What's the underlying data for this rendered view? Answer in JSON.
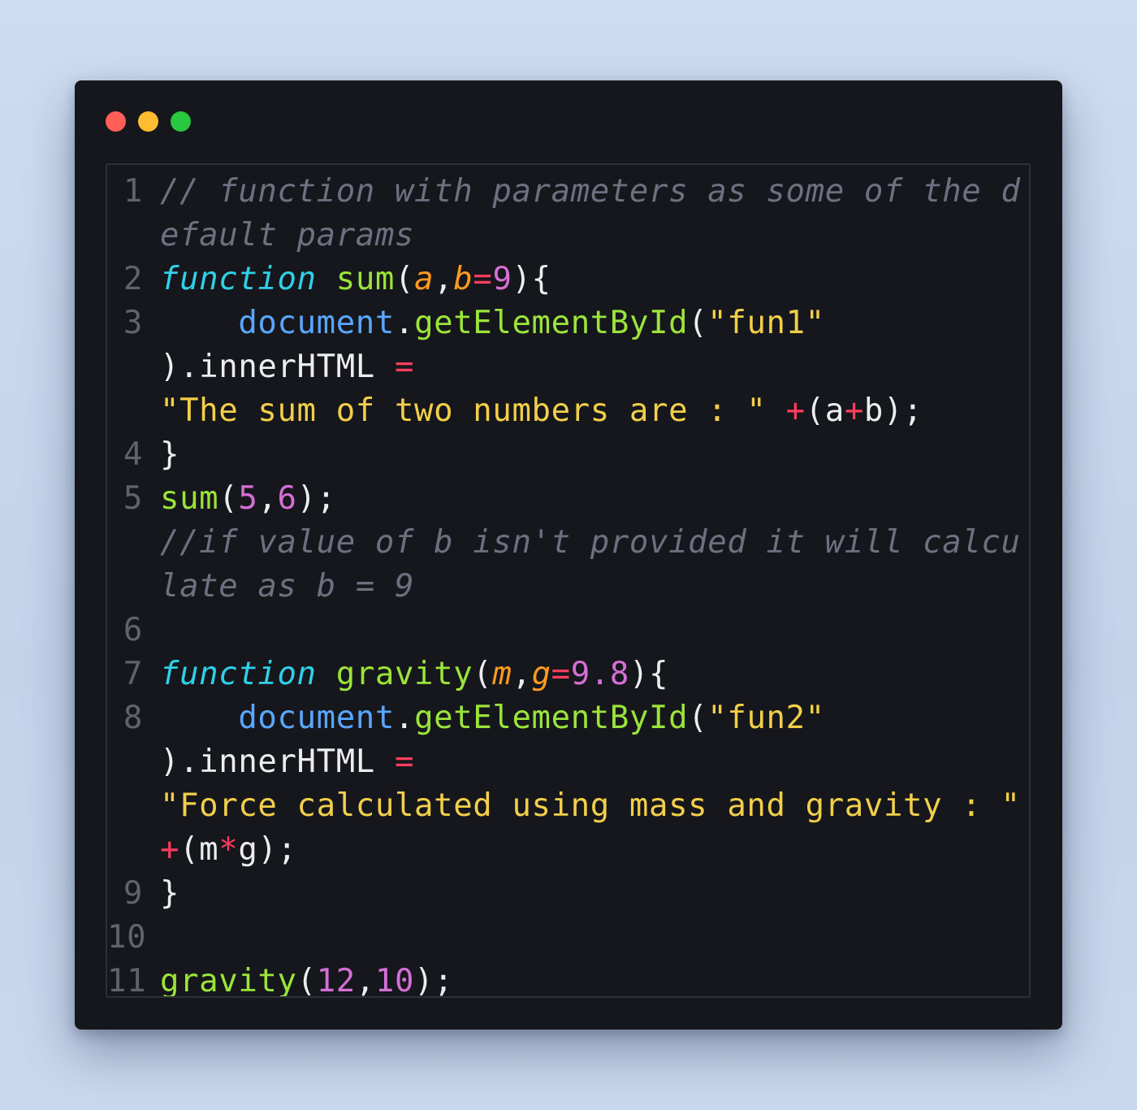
{
  "window": {
    "controls": [
      "close",
      "minimize",
      "maximize"
    ],
    "colors": {
      "close": "#ff5f57",
      "minimize": "#febc2e",
      "maximize": "#28c840"
    }
  },
  "code": {
    "numbers": [
      "1",
      "2",
      "3",
      "4",
      "5",
      "6",
      "7",
      "8",
      "9",
      "10",
      "11"
    ],
    "line1_a": "// function with parameters as some of the d",
    "line1_b": "efault params",
    "line2": {
      "kw": "function",
      "fn": "sum",
      "p1": "(",
      "a": "a",
      "comma": ",",
      "b": "b",
      "eq": "=",
      "n9": "9",
      "p2": "){"
    },
    "line3_a": {
      "indent": "    ",
      "obj": "document",
      "dot": ".",
      "fn": "getElementById",
      "paren": "(",
      "str": "\"fun1\""
    },
    "line3_b": {
      "plain": ").innerHTML ",
      "op": "="
    },
    "line3_c": {
      "str": "\"The sum of two numbers are : \" ",
      "plus1": "+",
      "p1": "(a",
      "plus2": "+",
      "p2": "b);"
    },
    "line4": "}",
    "line5": {
      "fn": "sum",
      "p1": "(",
      "n5": "5",
      "comma": ",",
      "n6": "6",
      "p2": ");"
    },
    "line5_c1": "//if value of b isn't provided it will calcu",
    "line5_c2": "late as b = 9",
    "line7": {
      "kw": "function",
      "fn": "gravity",
      "p1": "(",
      "m": "m",
      "comma": ",",
      "g": "g",
      "eq": "=",
      "num": "9.8",
      "p2": "){"
    },
    "line8_a": {
      "indent": "    ",
      "obj": "document",
      "dot": ".",
      "fn": "getElementById",
      "paren": "(",
      "str": "\"fun2\""
    },
    "line8_b": {
      "plain": ").innerHTML ",
      "op": "="
    },
    "line8_c": {
      "str": "\"Force calculated using mass and gravity : \""
    },
    "line8_d": {
      "plus": "+",
      "p1": "(m",
      "star": "*",
      "p2": "g);"
    },
    "line9": "}",
    "line11": {
      "fn": "gravity",
      "p1": "(",
      "n12": "12",
      "comma": ",",
      "n10": "10",
      "p2": ");"
    }
  }
}
